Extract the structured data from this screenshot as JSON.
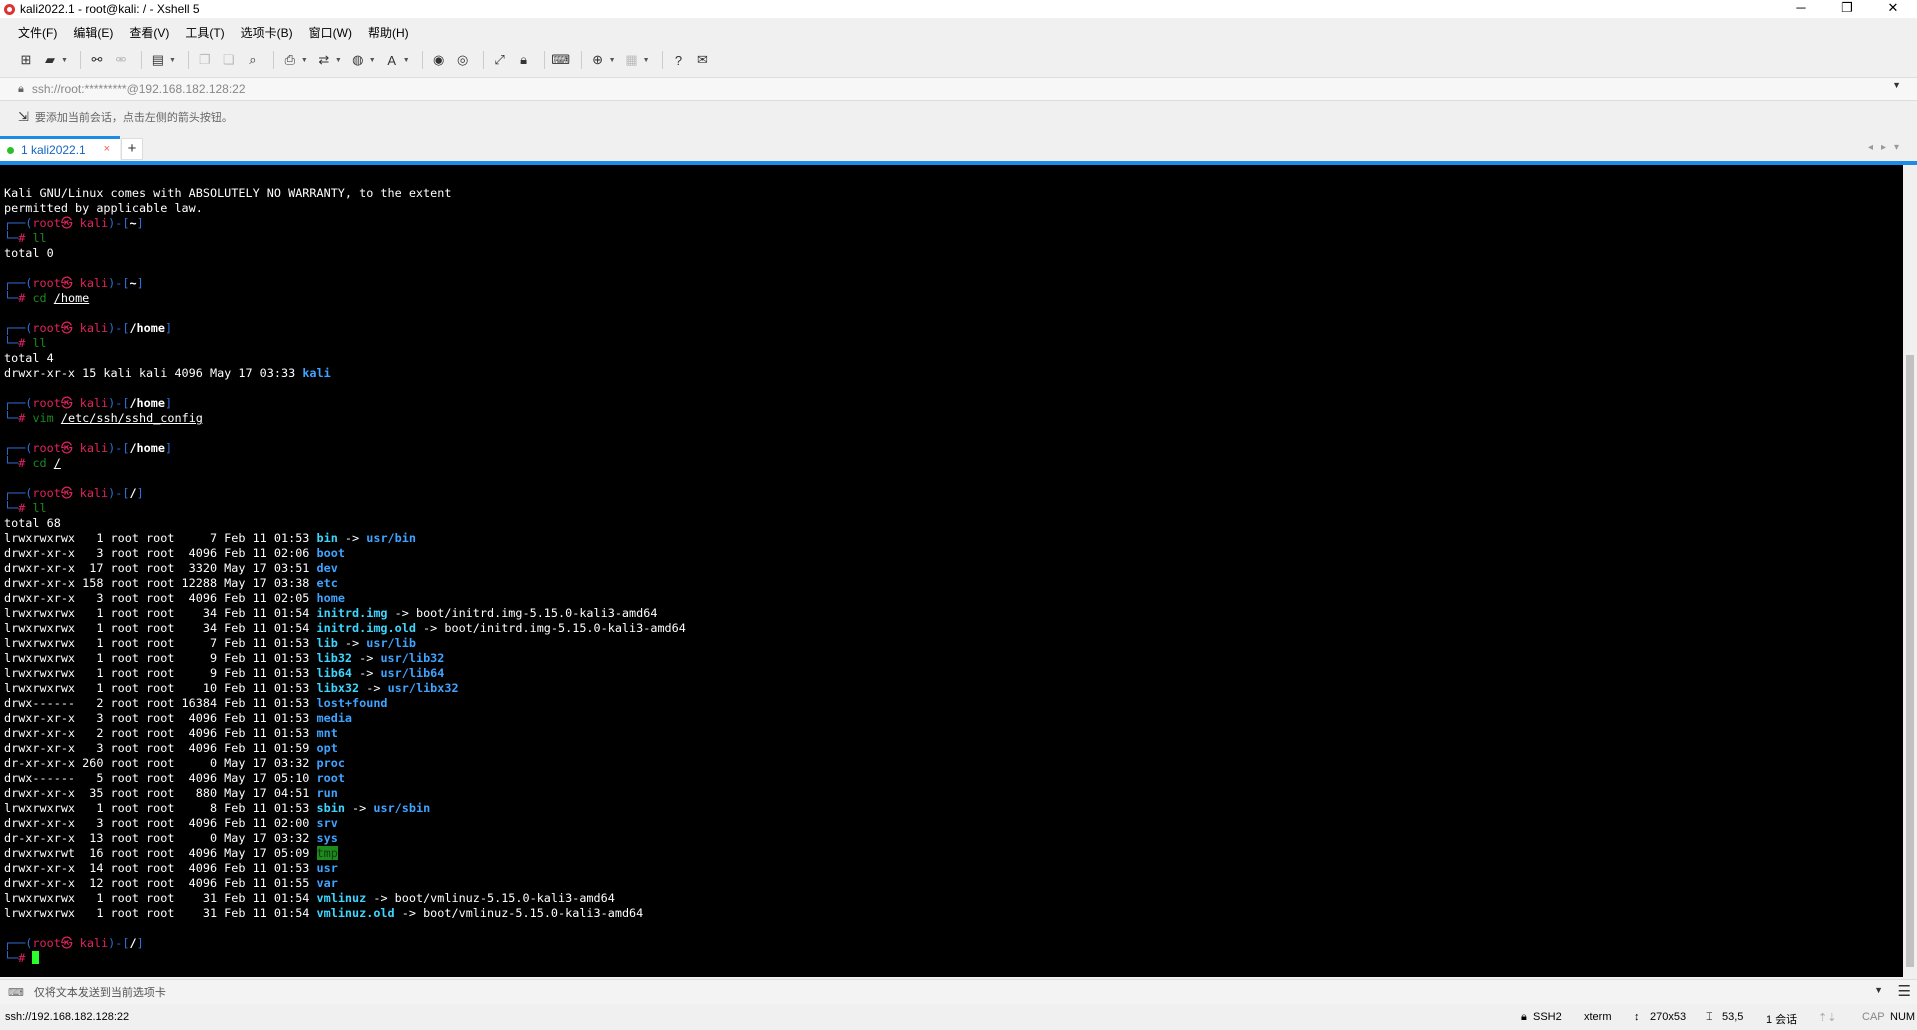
{
  "window": {
    "title": "kali2022.1 - root@kali: / - Xshell 5",
    "minimize": "─",
    "maximize": "❐",
    "close": "✕"
  },
  "menu": [
    "文件(F)",
    "编辑(E)",
    "查看(V)",
    "工具(T)",
    "选项卡(B)",
    "窗口(W)",
    "帮助(H)"
  ],
  "address": {
    "text": "ssh://root:*********@192.168.182.128:22"
  },
  "hint": {
    "text": "要添加当前会话，点击左侧的箭头按钮。"
  },
  "tab": {
    "label": "1 kali2022.1",
    "close": "×",
    "add": "+"
  },
  "terminal": {
    "intro": [
      "Kali GNU/Linux comes with ABSOLUTELY NO WARRANTY, to the extent",
      "permitted by applicable law."
    ],
    "prompt_user": "root",
    "prompt_host": "kali",
    "prompt_at": "㉿",
    "cmd1": "ll",
    "out1": "total 0",
    "dir_home": "~",
    "cmd2": "cd",
    "cmd2_arg": "/home",
    "dir_homedir": "/home",
    "cmd3": "ll",
    "out3_total": "total 4",
    "out3_line": "drwxr-xr-x 15 kali kali 4096 May 17 03:33 ",
    "out3_name": "kali",
    "cmd4": "vim",
    "cmd4_arg": "/etc/ssh/sshd_config",
    "cmd5": "cd",
    "cmd5_arg": "/",
    "dir_root": "/",
    "cmd6": "ll",
    "out6_total": "total 68",
    "listing": [
      {
        "meta": "lrwxrwxrwx   1 root root     7 Feb 11 01:53 ",
        "name": "bin",
        "kind": "link",
        "target": "usr/bin",
        "tkind": "dir"
      },
      {
        "meta": "drwxr-xr-x   3 root root  4096 Feb 11 02:06 ",
        "name": "boot",
        "kind": "dir"
      },
      {
        "meta": "drwxr-xr-x  17 root root  3320 May 17 03:51 ",
        "name": "dev",
        "kind": "dir"
      },
      {
        "meta": "drwxr-xr-x 158 root root 12288 May 17 03:38 ",
        "name": "etc",
        "kind": "dir"
      },
      {
        "meta": "drwxr-xr-x   3 root root  4096 Feb 11 02:05 ",
        "name": "home",
        "kind": "dir"
      },
      {
        "meta": "lrwxrwxrwx   1 root root    34 Feb 11 01:54 ",
        "name": "initrd.img",
        "kind": "link",
        "target": "boot/initrd.img-5.15.0-kali3-amd64",
        "tkind": "plain"
      },
      {
        "meta": "lrwxrwxrwx   1 root root    34 Feb 11 01:54 ",
        "name": "initrd.img.old",
        "kind": "link",
        "target": "boot/initrd.img-5.15.0-kali3-amd64",
        "tkind": "plain"
      },
      {
        "meta": "lrwxrwxrwx   1 root root     7 Feb 11 01:53 ",
        "name": "lib",
        "kind": "link",
        "target": "usr/lib",
        "tkind": "dir"
      },
      {
        "meta": "lrwxrwxrwx   1 root root     9 Feb 11 01:53 ",
        "name": "lib32",
        "kind": "link",
        "target": "usr/lib32",
        "tkind": "dir"
      },
      {
        "meta": "lrwxrwxrwx   1 root root     9 Feb 11 01:53 ",
        "name": "lib64",
        "kind": "link",
        "target": "usr/lib64",
        "tkind": "dir"
      },
      {
        "meta": "lrwxrwxrwx   1 root root    10 Feb 11 01:53 ",
        "name": "libx32",
        "kind": "link",
        "target": "usr/libx32",
        "tkind": "dir"
      },
      {
        "meta": "drwx------   2 root root 16384 Feb 11 01:53 ",
        "name": "lost+found",
        "kind": "dir"
      },
      {
        "meta": "drwxr-xr-x   3 root root  4096 Feb 11 01:53 ",
        "name": "media",
        "kind": "dir"
      },
      {
        "meta": "drwxr-xr-x   2 root root  4096 Feb 11 01:53 ",
        "name": "mnt",
        "kind": "dir"
      },
      {
        "meta": "drwxr-xr-x   3 root root  4096 Feb 11 01:59 ",
        "name": "opt",
        "kind": "dir"
      },
      {
        "meta": "dr-xr-xr-x 260 root root     0 May 17 03:32 ",
        "name": "proc",
        "kind": "dir"
      },
      {
        "meta": "drwx------   5 root root  4096 May 17 05:10 ",
        "name": "root",
        "kind": "dir"
      },
      {
        "meta": "drwxr-xr-x  35 root root   880 May 17 04:51 ",
        "name": "run",
        "kind": "dir"
      },
      {
        "meta": "lrwxrwxrwx   1 root root     8 Feb 11 01:53 ",
        "name": "sbin",
        "kind": "link",
        "target": "usr/sbin",
        "tkind": "dir"
      },
      {
        "meta": "drwxr-xr-x   3 root root  4096 Feb 11 02:00 ",
        "name": "srv",
        "kind": "dir"
      },
      {
        "meta": "dr-xr-xr-x  13 root root     0 May 17 03:32 ",
        "name": "sys",
        "kind": "dir"
      },
      {
        "meta": "drwxrwxrwt  16 root root  4096 May 17 05:09 ",
        "name": "tmp",
        "kind": "sticky"
      },
      {
        "meta": "drwxr-xr-x  14 root root  4096 Feb 11 01:53 ",
        "name": "usr",
        "kind": "dir"
      },
      {
        "meta": "drwxr-xr-x  12 root root  4096 Feb 11 01:55 ",
        "name": "var",
        "kind": "dir"
      },
      {
        "meta": "lrwxrwxrwx   1 root root    31 Feb 11 01:54 ",
        "name": "vmlinuz",
        "kind": "link",
        "target": "boot/vmlinuz-5.15.0-kali3-amd64",
        "tkind": "plain"
      },
      {
        "meta": "lrwxrwxrwx   1 root root    31 Feb 11 01:54 ",
        "name": "vmlinuz.old",
        "kind": "link",
        "target": "boot/vmlinuz-5.15.0-kali3-amd64",
        "tkind": "plain"
      }
    ],
    "arrow": " -> "
  },
  "compose": {
    "text": "仅将文本发送到当前选项卡"
  },
  "status": {
    "connection": "ssh://192.168.182.128:22",
    "protocol": "SSH2",
    "term": "xterm",
    "size": "270x53",
    "cursor": "53,5",
    "sessions": "1 会话",
    "cap": "CAP",
    "num": "NUM"
  },
  "colors": {
    "accent": "#1e8be6",
    "terminal_bg": "#000000",
    "dir": "#3fa3ff",
    "link": "#3fd5ff",
    "prompt_user": "#e0245e",
    "prompt_cmd": "#1c8a1c"
  }
}
